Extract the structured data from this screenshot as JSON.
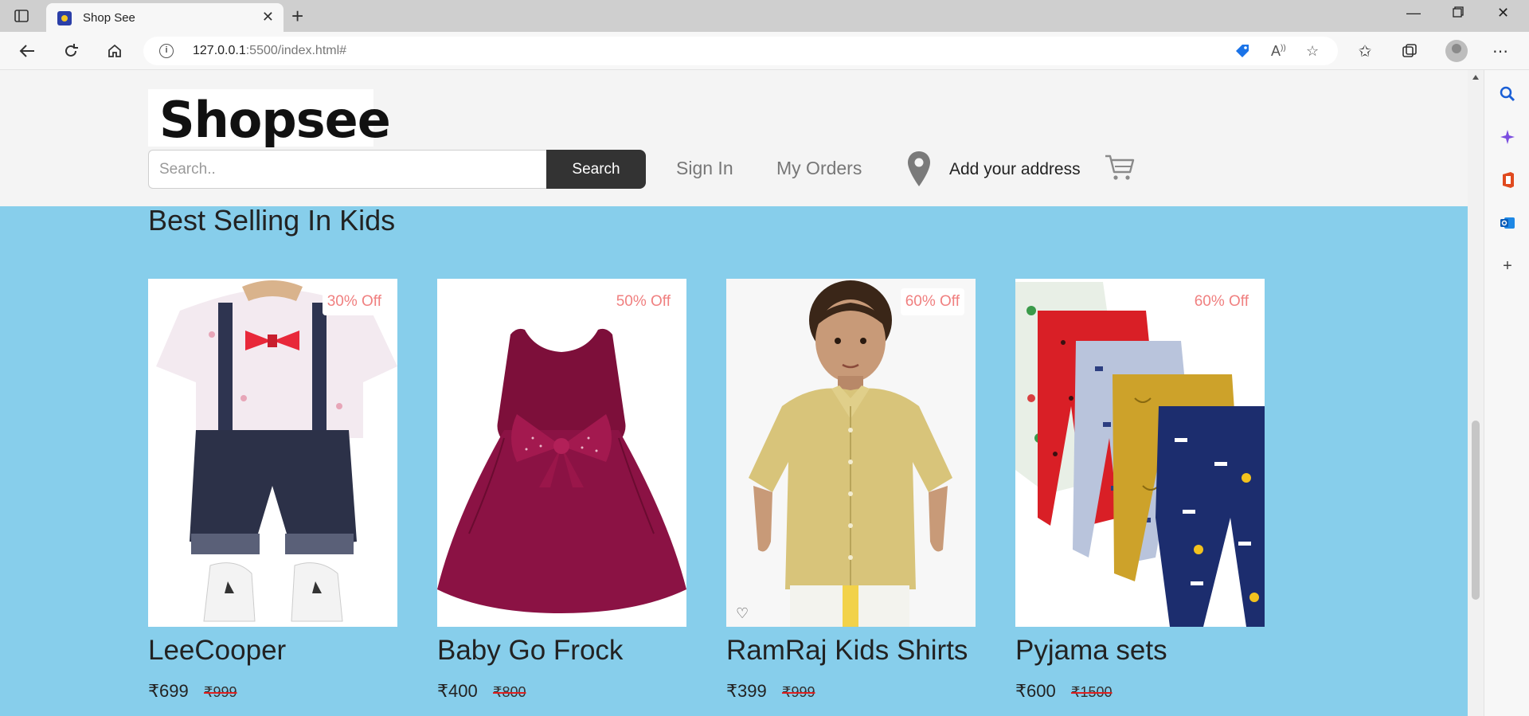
{
  "browser": {
    "tab_title": "Shop See",
    "url_host": "127.0.0.1",
    "url_rest": ":5500/index.html#"
  },
  "header": {
    "logo_text": "Shopsee",
    "search_placeholder": "Search..",
    "search_button": "Search",
    "sign_in": "Sign In",
    "my_orders": "My Orders",
    "address": "Add your address"
  },
  "section": {
    "title": "Best Selling In Kids"
  },
  "products": [
    {
      "name": "LeeCooper",
      "discount": "30% Off",
      "price": "₹699",
      "mrp": "₹999"
    },
    {
      "name": "Baby Go Frock",
      "discount": "50% Off",
      "price": "₹400",
      "mrp": "₹800"
    },
    {
      "name": "RamRaj Kids Shirts",
      "discount": "60% Off",
      "price": "₹399",
      "mrp": "₹999"
    },
    {
      "name": "Pyjama sets",
      "discount": "60% Off",
      "price": "₹600",
      "mrp": "₹1500"
    }
  ],
  "colors": {
    "page_bg": "#87ceeb",
    "header_bg": "#f4f4f4",
    "discount_text": "#f08080",
    "search_button_bg": "#333333",
    "strike_color": "#e02020"
  }
}
